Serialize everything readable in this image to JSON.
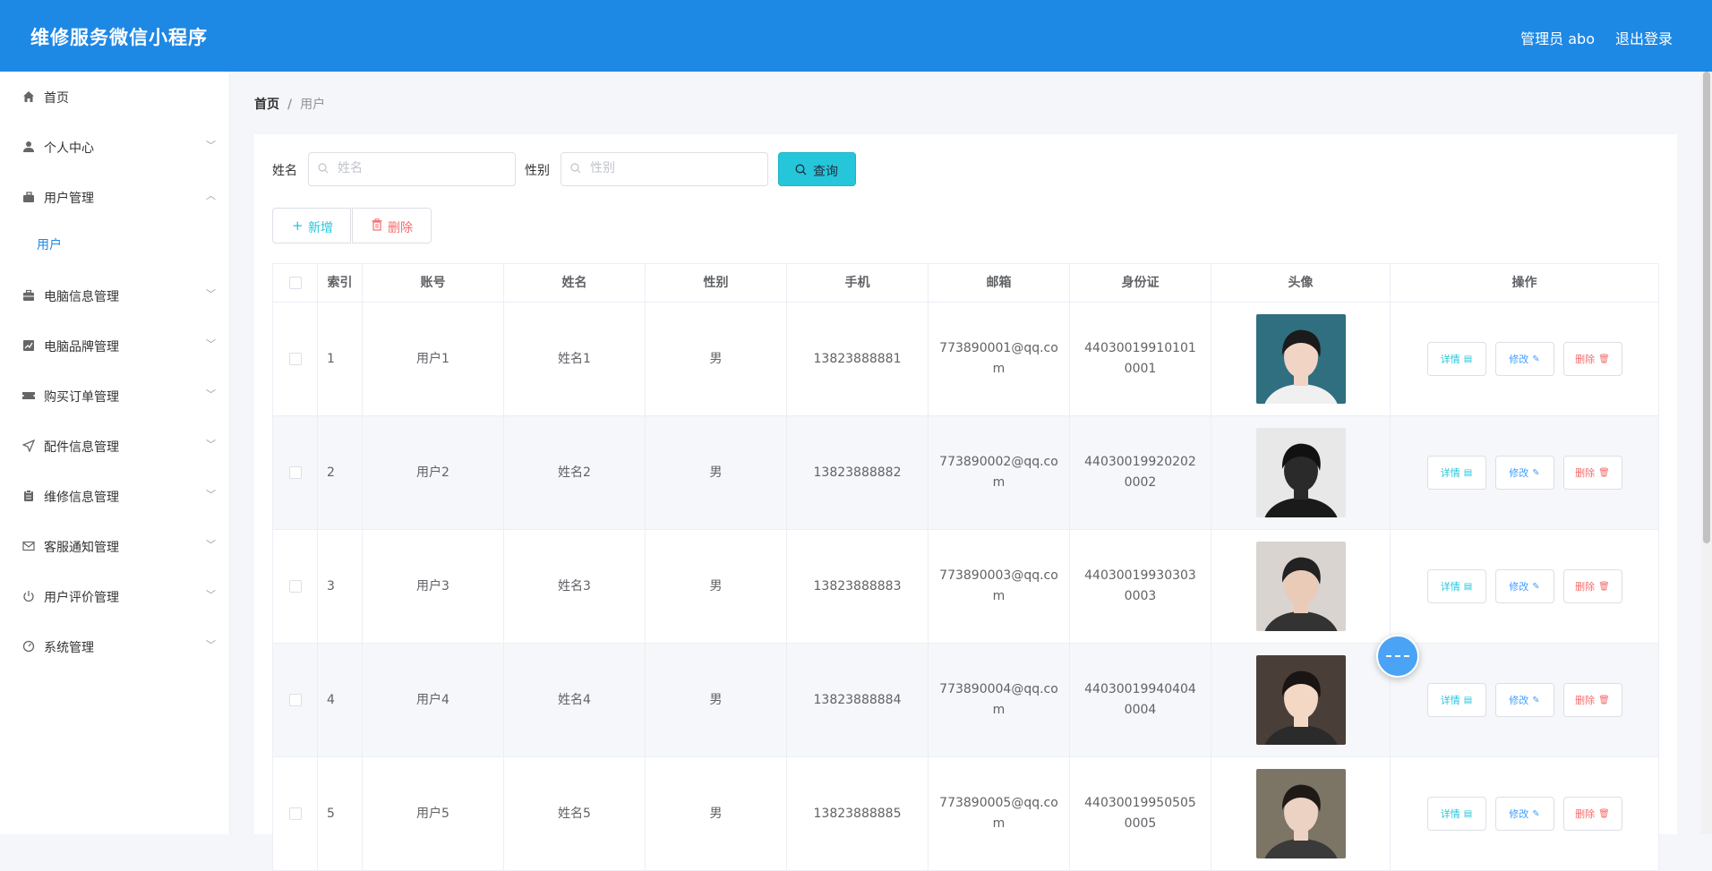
{
  "header": {
    "app_title": "维修服务微信小程序",
    "admin_label": "管理员 abo",
    "logout_label": "退出登录"
  },
  "sidebar": {
    "items": [
      {
        "label": "首页",
        "icon": "home-icon",
        "has_chevron": false
      },
      {
        "label": "个人中心",
        "icon": "user-icon",
        "has_chevron": true,
        "chevron": "down"
      },
      {
        "label": "用户管理",
        "icon": "briefcase-icon",
        "has_chevron": true,
        "chevron": "up"
      },
      {
        "label": "电脑信息管理",
        "icon": "suitcase-icon",
        "has_chevron": true,
        "chevron": "down"
      },
      {
        "label": "电脑品牌管理",
        "icon": "chart-icon",
        "has_chevron": true,
        "chevron": "down"
      },
      {
        "label": "购买订单管理",
        "icon": "ticket-icon",
        "has_chevron": true,
        "chevron": "down"
      },
      {
        "label": "配件信息管理",
        "icon": "send-icon",
        "has_chevron": true,
        "chevron": "down"
      },
      {
        "label": "维修信息管理",
        "icon": "clipboard-icon",
        "has_chevron": true,
        "chevron": "down"
      },
      {
        "label": "客服通知管理",
        "icon": "mail-icon",
        "has_chevron": true,
        "chevron": "down"
      },
      {
        "label": "用户评价管理",
        "icon": "power-icon",
        "has_chevron": true,
        "chevron": "down"
      },
      {
        "label": "系统管理",
        "icon": "dashboard-icon",
        "has_chevron": true,
        "chevron": "down"
      }
    ],
    "submenu": {
      "label": "用户"
    }
  },
  "breadcrumb": {
    "home": "首页",
    "separator": "/",
    "current": "用户"
  },
  "search": {
    "name_label": "姓名",
    "name_placeholder": "姓名",
    "gender_label": "性别",
    "gender_placeholder": "性别",
    "query_label": "查询"
  },
  "actions": {
    "add_label": "新增",
    "delete_label": "删除"
  },
  "table": {
    "columns": [
      "索引",
      "账号",
      "姓名",
      "性别",
      "手机",
      "邮箱",
      "身份证",
      "头像",
      "操作"
    ],
    "row_actions": {
      "detail": "详情",
      "edit": "修改",
      "remove": "删除"
    },
    "rows": [
      {
        "index": "1",
        "account": "用户1",
        "name": "姓名1",
        "gender": "男",
        "phone": "13823888881",
        "email": "773890001@qq.com",
        "id_card": "440300199101010001"
      },
      {
        "index": "2",
        "account": "用户2",
        "name": "姓名2",
        "gender": "男",
        "phone": "13823888882",
        "email": "773890002@qq.com",
        "id_card": "440300199202020002"
      },
      {
        "index": "3",
        "account": "用户3",
        "name": "姓名3",
        "gender": "男",
        "phone": "13823888883",
        "email": "773890003@qq.com",
        "id_card": "440300199303030003"
      },
      {
        "index": "4",
        "account": "用户4",
        "name": "姓名4",
        "gender": "男",
        "phone": "13823888884",
        "email": "773890004@qq.com",
        "id_card": "440300199404040004"
      },
      {
        "index": "5",
        "account": "用户5",
        "name": "姓名5",
        "gender": "男",
        "phone": "13823888885",
        "email": "773890005@qq.com",
        "id_card": "440300199505050005"
      }
    ]
  },
  "colors": {
    "header_bg": "#1e88e5",
    "accent_cyan": "#26c6da",
    "danger": "#f56c6c",
    "primary": "#409eff"
  }
}
